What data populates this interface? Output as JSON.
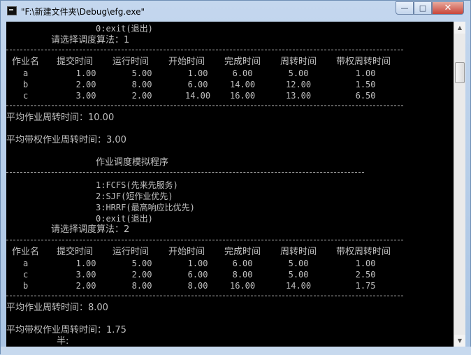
{
  "window": {
    "title": "\"F:\\新建文件夹\\Debug\\efg.exe\"",
    "controls": {
      "minimize": "—",
      "maximize": "□",
      "close": "✕"
    }
  },
  "console": {
    "top_exit": "0:exit(退出)",
    "prompt1": "请选择调度算法：1",
    "headers": [
      "作业名",
      "提交时间",
      "运行时间",
      "开始时间",
      "完成时间",
      "周转时间",
      "带权周转时间"
    ],
    "table1": [
      [
        "a",
        "1.00",
        "5.00",
        "1.00",
        "6.00",
        "5.00",
        "1.00"
      ],
      [
        "b",
        "2.00",
        "8.00",
        "6.00",
        "14.00",
        "12.00",
        "1.50"
      ],
      [
        "c",
        "3.00",
        "2.00",
        "14.00",
        "16.00",
        "13.00",
        "6.50"
      ]
    ],
    "avg1": "平均作业周转时间：10.00",
    "wavg1": "平均带权作业周转时间：3.00",
    "menu_title": "作业调度模拟程序",
    "menu_items": [
      "1:FCFS(先来先服务)",
      "2:SJF(短作业优先)",
      "3:HRRF(最高响应比优先)",
      "0:exit(退出)"
    ],
    "prompt2": "请选择调度算法：2",
    "table2": [
      [
        "a",
        "1.00",
        "5.00",
        "1.00",
        "6.00",
        "5.00",
        "1.00"
      ],
      [
        "c",
        "3.00",
        "2.00",
        "6.00",
        "8.00",
        "5.00",
        "2.50"
      ],
      [
        "b",
        "2.00",
        "8.00",
        "8.00",
        "16.00",
        "14.00",
        "1.75"
      ]
    ],
    "avg2": "平均作业周转时间：8.00",
    "wavg2": "平均带权作业周转时间：1.75",
    "ime_status": "半:"
  },
  "colors": {
    "console_bg": "#000000",
    "console_text": "#c0c0c0",
    "titlebar": "#b9d1ea"
  }
}
